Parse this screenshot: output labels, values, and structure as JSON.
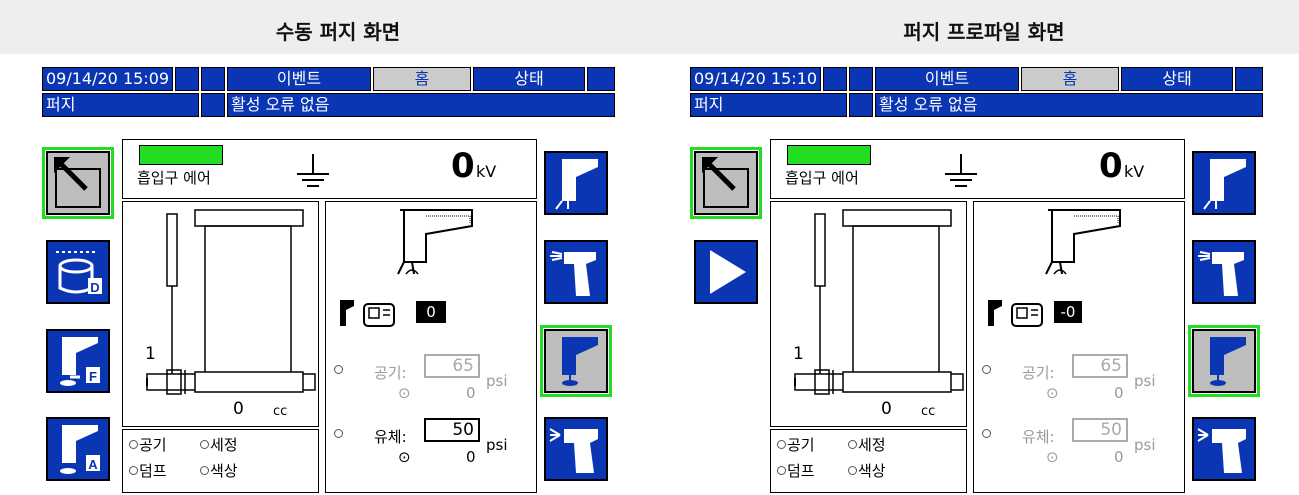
{
  "captions": {
    "left": "수동 퍼지 화면",
    "right": "퍼지 프로파일 화면"
  },
  "screens": [
    {
      "datetime": "09/14/20 15:09",
      "tabs": {
        "events": "이벤트",
        "home": "홈",
        "status": "상태"
      },
      "mode": "퍼지",
      "status_message": "활성 오류 없음",
      "inlet_air_label": "흡입구 에어",
      "kv_value": "0",
      "kv_unit": "kV",
      "pump_stroke_label": "1",
      "volume_value": "0",
      "volume_unit": "cc",
      "purge_index": "0",
      "air": {
        "label": "공기:",
        "set_value": "65",
        "actual": "0",
        "unit": "psi",
        "enabled": false
      },
      "fluid": {
        "label": "유체:",
        "set_value": "50",
        "actual": "0",
        "unit": "psi",
        "enabled": true
      },
      "legend": {
        "air": "공기",
        "wash": "세정",
        "dump": "덤프",
        "color": "색상"
      },
      "left_buttons": [
        "exit-screen",
        "drum-dump",
        "gun-flush",
        "gun-auto"
      ],
      "selected_right_button": 2
    },
    {
      "datetime": "09/14/20 15:10",
      "tabs": {
        "events": "이벤트",
        "home": "홈",
        "status": "상태"
      },
      "mode": "퍼지",
      "status_message": "활성 오류 없음",
      "inlet_air_label": "흡입구 에어",
      "kv_value": "0",
      "kv_unit": "kV",
      "pump_stroke_label": "1",
      "volume_value": "0",
      "volume_unit": "cc",
      "purge_index": "-0",
      "air": {
        "label": "공기:",
        "set_value": "65",
        "actual": "0",
        "unit": "psi",
        "enabled": false
      },
      "fluid": {
        "label": "유체:",
        "set_value": "50",
        "actual": "0",
        "unit": "psi",
        "enabled": false
      },
      "legend": {
        "air": "공기",
        "wash": "세정",
        "dump": "덤프",
        "color": "색상"
      },
      "left_buttons": [
        "exit-screen",
        "start-play"
      ],
      "selected_right_button": 2
    }
  ],
  "colors": {
    "accent_blue": "#0b36b3",
    "indicator_green": "#22dd22",
    "panel_gray": "#cbcbcb"
  }
}
